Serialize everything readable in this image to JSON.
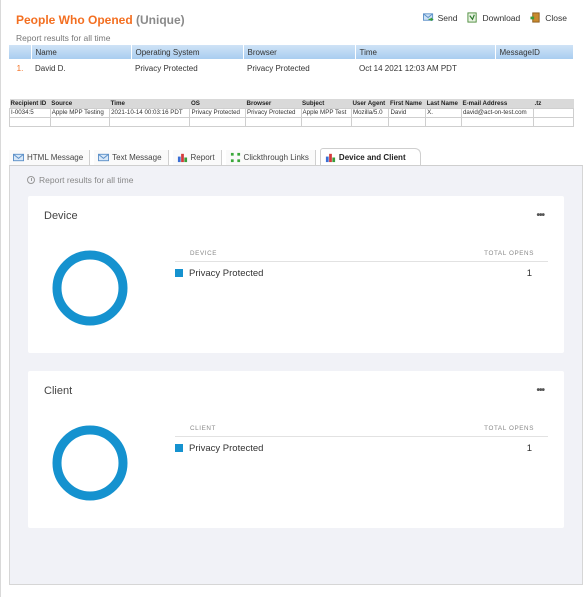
{
  "header": {
    "title": "People Who Opened",
    "title_suffix": "(Unique)",
    "subtitle": "Report results for all time",
    "actions": [
      {
        "label": "Send",
        "icon": "send-icon"
      },
      {
        "label": "Download",
        "icon": "download-icon"
      },
      {
        "label": "Close",
        "icon": "close-door-icon"
      }
    ]
  },
  "summary_table": {
    "columns": [
      "",
      "Name",
      "Operating System",
      "Browser",
      "Time",
      "MessageID"
    ],
    "rows": [
      {
        "num": "1.",
        "name": "David D.",
        "os": "Privacy Protected",
        "browser": "Privacy Protected",
        "time": "Oct 14 2021 12:03 AM PDT",
        "message_id": ""
      }
    ]
  },
  "raw_table": {
    "columns": [
      "Recipient ID",
      "Source",
      "Time",
      "OS",
      "Browser",
      "Subject",
      "User Agent",
      "First Name",
      "Last Name",
      "E-mail Address",
      ".tz"
    ],
    "rows": [
      [
        "I-0034:5",
        "Apple MPP Testing",
        "2021-10-14 00:03:16 PDT",
        "Privacy Protected",
        "Privacy Protected",
        "Apple MPP Test",
        "Mozilla/5.0",
        "David",
        "X.",
        "david@act-on-test.com",
        ""
      ]
    ]
  },
  "tabs": [
    {
      "label": "HTML Message",
      "icon": "envelope-icon",
      "active": false
    },
    {
      "label": "Text Message",
      "icon": "envelope-icon",
      "active": false
    },
    {
      "label": "Report",
      "icon": "bar-chart-icon",
      "active": false
    },
    {
      "label": "Clickthrough Links",
      "icon": "link-grid-icon",
      "active": false
    },
    {
      "label": "Device and Client",
      "icon": "bar-chart-icon",
      "active": true
    }
  ],
  "panel": {
    "range_label": "Report results for all time",
    "cards": [
      {
        "title": "Device",
        "col_label": "DEVICE",
        "value_label": "TOTAL OPENS",
        "rows": [
          {
            "label": "Privacy Protected",
            "value": "1",
            "color": "#1592cf"
          }
        ]
      },
      {
        "title": "Client",
        "col_label": "CLIENT",
        "value_label": "TOTAL OPENS",
        "rows": [
          {
            "label": "Privacy Protected",
            "value": "1",
            "color": "#1592cf"
          }
        ]
      }
    ]
  },
  "colors": {
    "accent": "#f36f21",
    "chart": "#1592cf"
  }
}
